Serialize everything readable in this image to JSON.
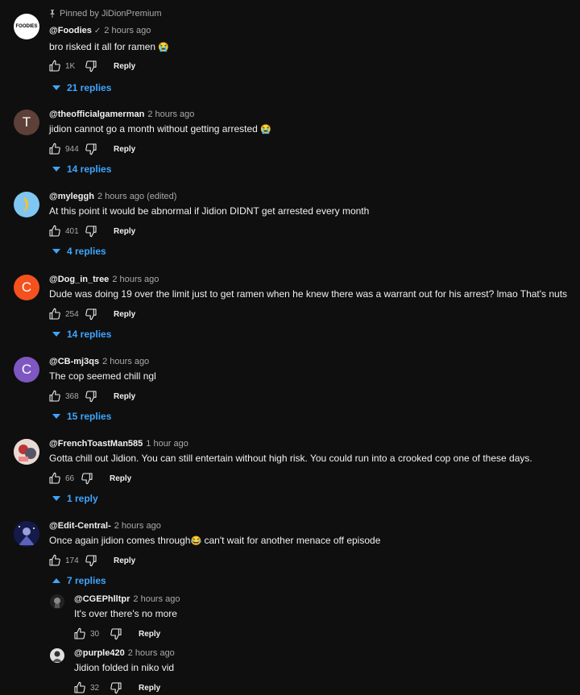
{
  "comments": [
    {
      "pinned_label": "Pinned by JiDionPremium",
      "author": "@Foodies",
      "time": "2 hours ago",
      "text": "bro risked it all for ramen",
      "emoji": "😭",
      "likes": "1K",
      "reply_label": "Reply",
      "replies_label": "21 replies",
      "avatar_text": "FOODIES",
      "avatar_color": "#ffffff"
    },
    {
      "author": "@theofficialgamerman",
      "time": "2 hours ago",
      "text": "jidion cannot go a month without getting arrested",
      "emoji": "😭",
      "likes": "944",
      "reply_label": "Reply",
      "replies_label": "14 replies",
      "avatar_text": "T",
      "avatar_color": "#5d4037"
    },
    {
      "author": "@myleggh",
      "time": "2 hours ago (edited)",
      "text": "At this point it would be abnormal if Jidion DIDNT get arrested every month",
      "likes": "401",
      "reply_label": "Reply",
      "replies_label": "4 replies",
      "avatar_color": "#7fc6f2"
    },
    {
      "author": "@Dog_in_tree",
      "time": "2 hours ago",
      "text": "Dude was doing 19 over the limit just to get ramen when he knew there was a warrant out for his arrest? lmao That's nuts",
      "likes": "254",
      "reply_label": "Reply",
      "replies_label": "14 replies",
      "avatar_text": "C",
      "avatar_color": "#f4511e"
    },
    {
      "author": "@CB-mj3qs",
      "time": "2 hours ago",
      "text": "The cop seemed chill ngl",
      "likes": "368",
      "reply_label": "Reply",
      "replies_label": "15 replies",
      "avatar_text": "C",
      "avatar_color": "#7e57c2"
    },
    {
      "author": "@FrenchToastMan585",
      "time": "1 hour ago",
      "text": "Gotta chill out Jidion. You can still entertain without high risk. You could run into a crooked cop one of these days.",
      "likes": "66",
      "reply_label": "Reply",
      "replies_label": "1 reply",
      "avatar_color": "#c9b4b0"
    },
    {
      "author": "@Edit-Central-",
      "time": "2 hours ago",
      "text": "Once again jidion comes through",
      "emoji": "😂",
      "text_after": " can't wait for another menace off episode",
      "likes": "174",
      "reply_label": "Reply",
      "replies_label": "7 replies",
      "avatar_color": "#1a237e"
    }
  ],
  "replies": [
    {
      "author": "@CGEPhlltpr",
      "time": "2 hours ago",
      "text": "It's over there's no more",
      "likes": "30",
      "reply_label": "Reply",
      "avatar_color": "#222222"
    },
    {
      "author": "@purple420",
      "time": "2 hours ago",
      "text": "Jidion folded in niko vid",
      "likes": "32",
      "reply_label": "Reply",
      "avatar_color": "#e0e0e0"
    }
  ]
}
